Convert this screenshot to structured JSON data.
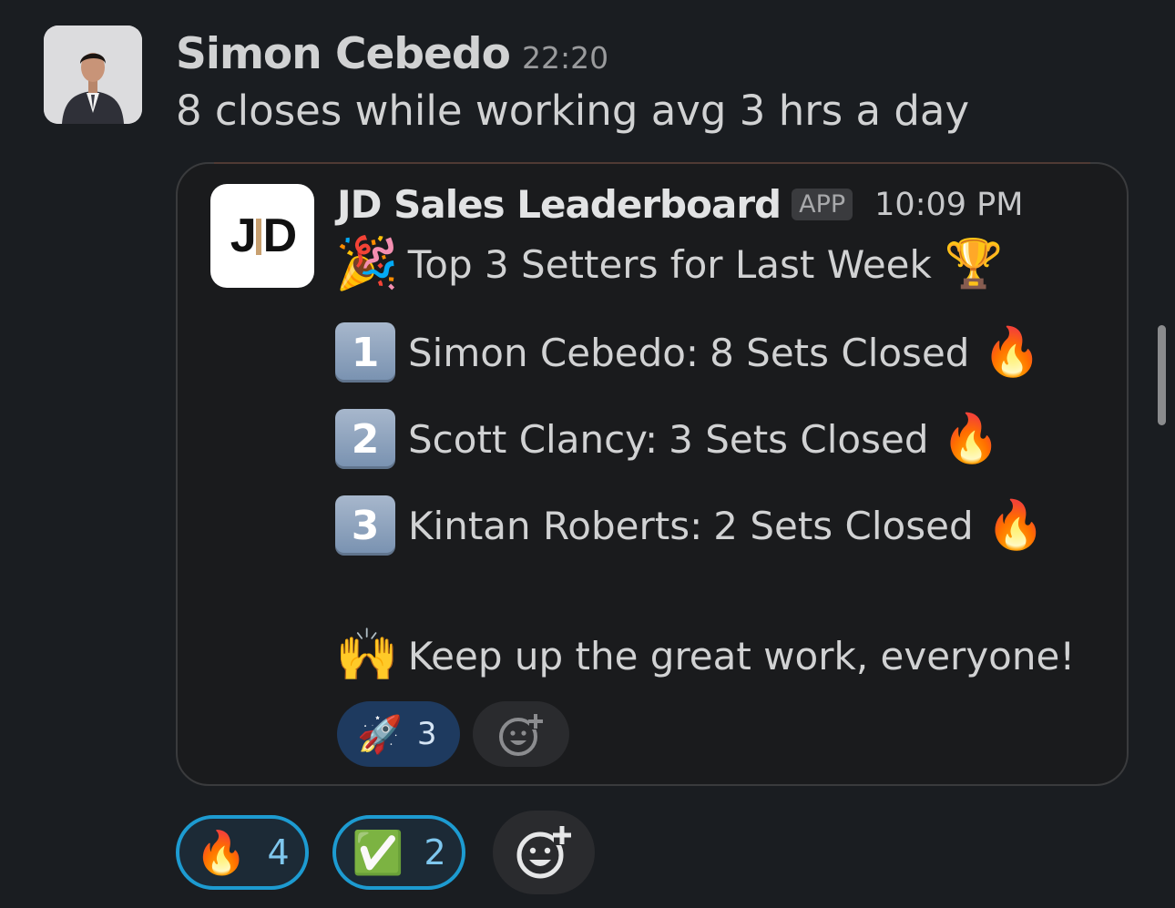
{
  "message": {
    "author": "Simon Cebedo",
    "time": "22:20",
    "text": "8 closes while working avg 3 hrs a day"
  },
  "app_card": {
    "logo_text_left": "J",
    "logo_text_right": "D",
    "app_name": "JD Sales Leaderboard",
    "badge": "APP",
    "time": "10:09 PM",
    "headline": {
      "emoji_before": "🎉",
      "text": "Top 3 Setters for Last Week",
      "emoji_after": "🏆"
    },
    "entries": [
      {
        "rank": "1",
        "name": "Simon Cebedo:",
        "result": "8 Sets Closed",
        "emoji": "🔥"
      },
      {
        "rank": "2",
        "name": "Scott Clancy:",
        "result": "3 Sets Closed",
        "emoji": "🔥"
      },
      {
        "rank": "3",
        "name": "Kintan Roberts:",
        "result": "2 Sets Closed",
        "emoji": "🔥"
      }
    ],
    "footer": {
      "emoji": "🙌",
      "text": "Keep up the great work, everyone!"
    },
    "reactions": [
      {
        "emoji": "🚀",
        "count": "3"
      }
    ]
  },
  "reactions": [
    {
      "emoji": "🔥",
      "count": "4"
    },
    {
      "emoji": "✅",
      "count": "2"
    }
  ],
  "icons": {
    "add_reaction": "add-reaction-icon",
    "avatar": "user-avatar"
  },
  "colors": {
    "background": "#1a1d21",
    "reaction_border": "#1d9bd1",
    "reaction_count": "#7fc7ee",
    "inner_reaction_bg": "#1e3a5f"
  }
}
